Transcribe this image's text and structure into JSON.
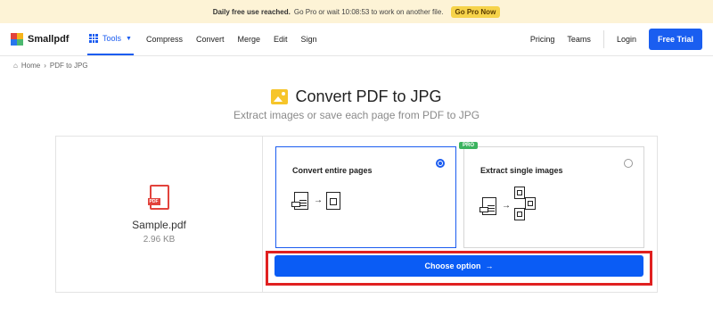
{
  "banner": {
    "bold": "Daily free use reached.",
    "text": "Go Pro or wait 10:08:53 to work on another file.",
    "cta": "Go Pro Now"
  },
  "nav": {
    "brand": "Smallpdf",
    "tools": "Tools",
    "links": [
      "Compress",
      "Convert",
      "Merge",
      "Edit",
      "Sign"
    ],
    "pricing": "Pricing",
    "teams": "Teams",
    "login": "Login",
    "trial": "Free Trial"
  },
  "breadcrumb": {
    "home": "Home",
    "current": "PDF to JPG"
  },
  "page": {
    "title": "Convert PDF to JPG",
    "subtitle": "Extract images or save each page from PDF to JPG"
  },
  "file": {
    "name": "Sample.pdf",
    "size": "2.96 KB",
    "badge": "PDF"
  },
  "options": [
    {
      "label": "Convert entire pages",
      "selected": true
    },
    {
      "label": "Extract single images",
      "selected": false,
      "badge": "PRO"
    }
  ],
  "choose": {
    "label": "Choose option"
  },
  "colors": {
    "accent": "#1b5cf0",
    "highlight": "#e02020",
    "pro": "#3bb35e"
  }
}
